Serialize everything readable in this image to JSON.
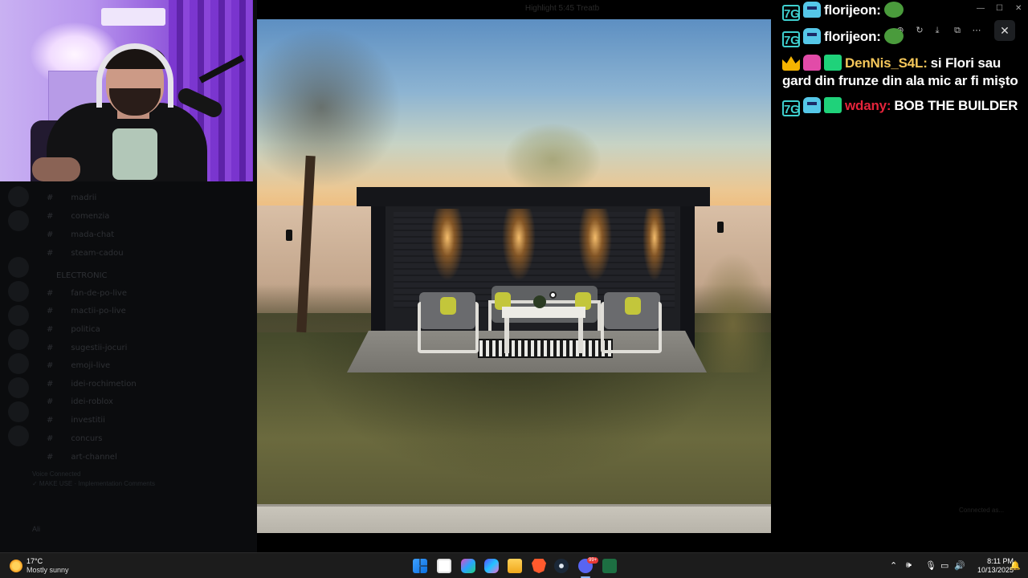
{
  "viewer": {
    "title": "Highlight 5:45 Treatb"
  },
  "discord": {
    "channels": [
      "madrii",
      "comenzia",
      "mada-chat",
      "steam-cadou",
      "ELECTRONIC",
      "fan-de-po-live",
      "mactii-po-live",
      "politica",
      "sugestii-jocuri",
      "emoji-live",
      "idei-rochimetion",
      "idei-roblox",
      "investitii",
      "concurs",
      "art-channel"
    ],
    "voice_status": "Voice Connected",
    "voice_detail": "✓ MAKE USE · Implementation Comments",
    "user": "Ali"
  },
  "chat": {
    "messages": [
      {
        "badges": [
          "7g-badge",
          "bot-badge"
        ],
        "user": "florijeon:",
        "user_color": "#ffffff",
        "text": "",
        "emote": "pepe-emote"
      },
      {
        "badges": [
          "7g-badge",
          "bot-badge"
        ],
        "user": "florijeon:",
        "user_color": "#ffffff",
        "text": "",
        "emote": "pepe-emote"
      },
      {
        "badges": [
          "crown-badge",
          "pink-bot-badge",
          "gift-badge"
        ],
        "user": "DenNis_S4L:",
        "user_color": "#f5c75a",
        "text": "si Flori sau gard din frunze din ala mic ar fi mişto",
        "emote": ""
      },
      {
        "badges": [
          "7g-badge",
          "bot-badge",
          "gift-badge"
        ],
        "user": "wdany:",
        "user_color": "#e5243b",
        "text": "BOB THE BUILDER",
        "emote": ""
      }
    ],
    "connected_label": "Connected as..."
  },
  "taskbar": {
    "weather_temp": "17°C",
    "weather_desc": "Mostly sunny",
    "clock_time": "8:11 PM",
    "clock_date": "10/13/2025",
    "discord_badge": "99+"
  },
  "colors": {
    "accent_cyan": "#3fd0cf",
    "username_gold": "#f5c75a",
    "username_red": "#e5243b"
  }
}
